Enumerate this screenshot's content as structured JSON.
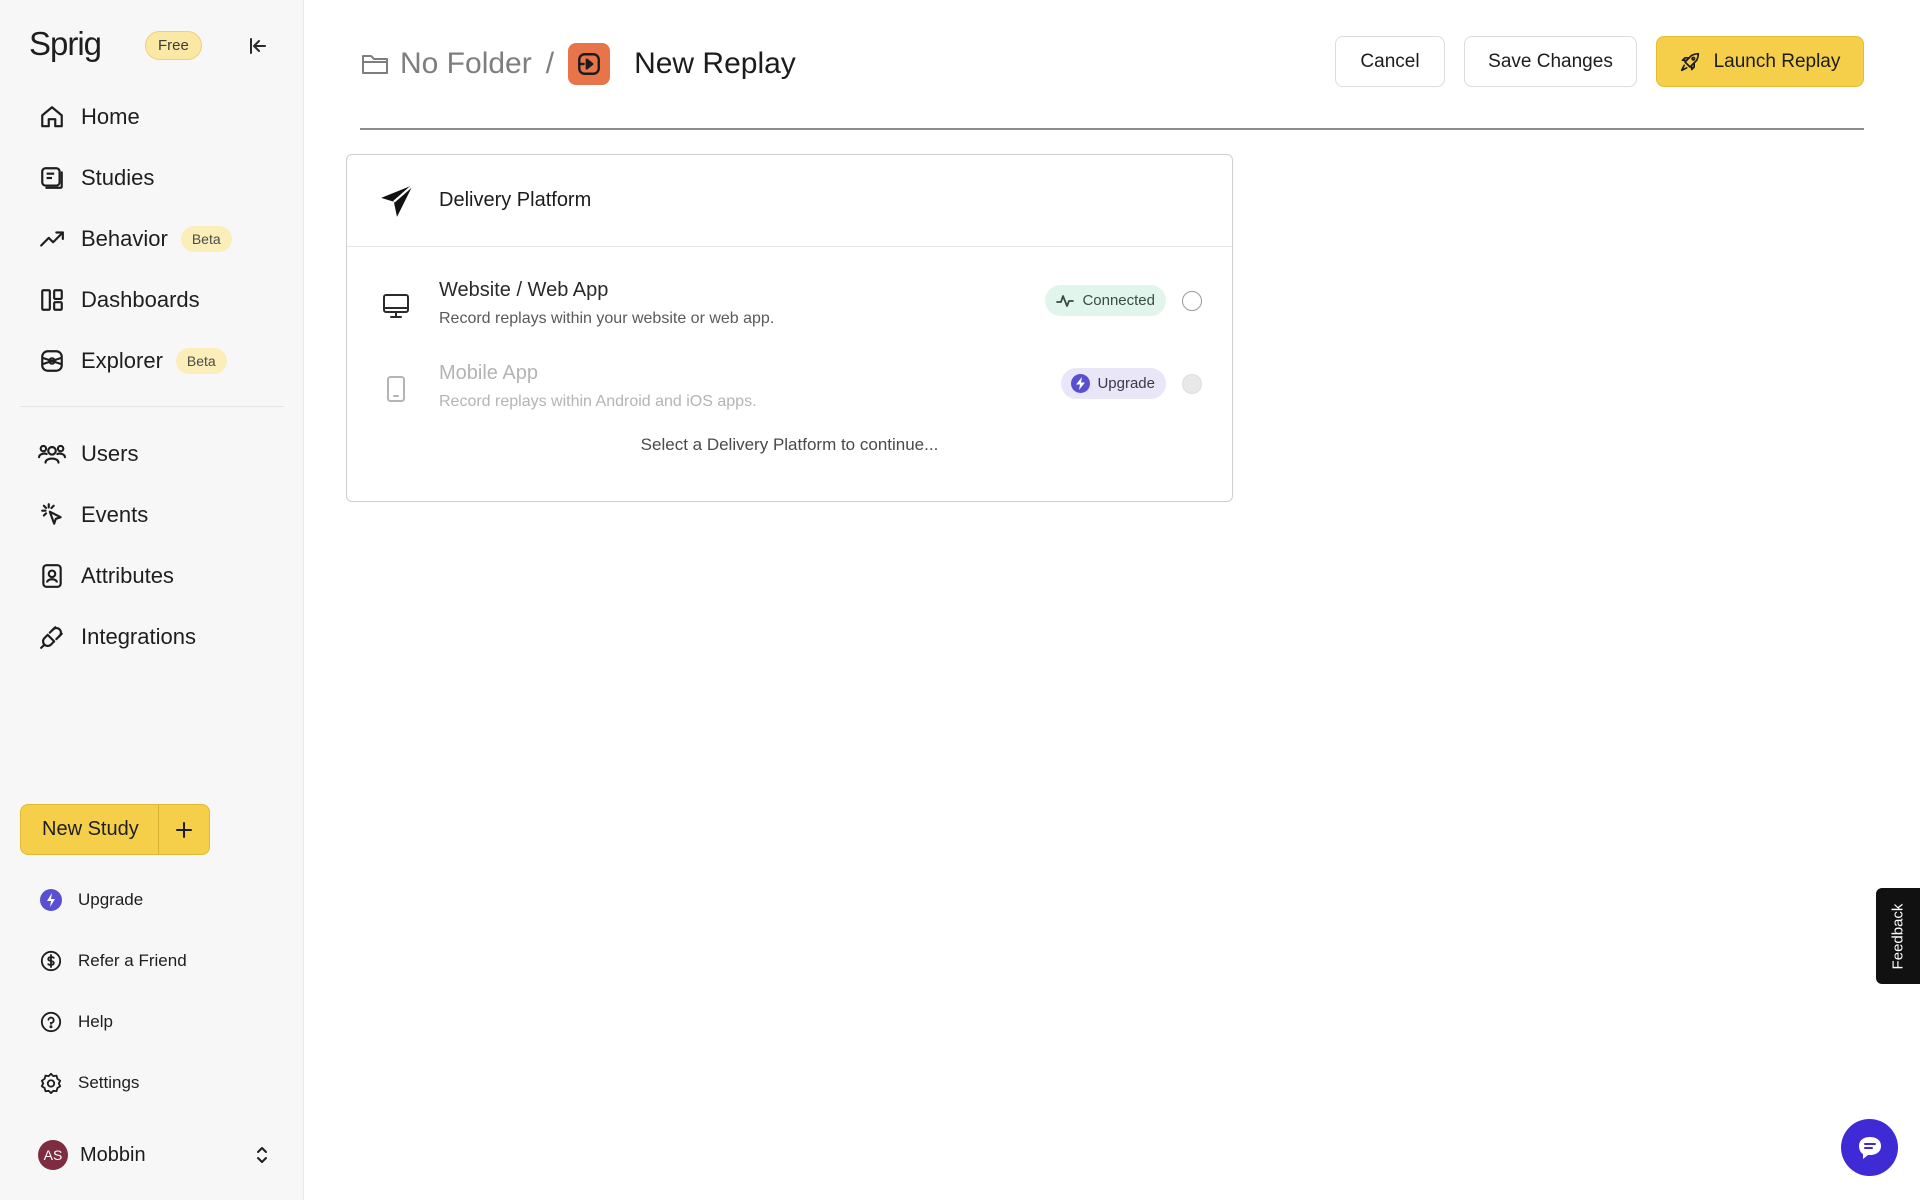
{
  "brand": {
    "logo_text": "Sprig",
    "plan_badge": "Free"
  },
  "sidebar": {
    "nav_primary": [
      {
        "label": "Home",
        "icon": "home-icon"
      },
      {
        "label": "Studies",
        "icon": "studies-icon"
      },
      {
        "label": "Behavior",
        "icon": "trend-icon",
        "badge": "Beta"
      },
      {
        "label": "Dashboards",
        "icon": "dashboards-icon"
      },
      {
        "label": "Explorer",
        "icon": "explorer-icon",
        "badge": "Beta"
      }
    ],
    "nav_secondary": [
      {
        "label": "Users",
        "icon": "users-icon"
      },
      {
        "label": "Events",
        "icon": "events-icon"
      },
      {
        "label": "Attributes",
        "icon": "attributes-icon"
      },
      {
        "label": "Integrations",
        "icon": "plug-icon"
      }
    ],
    "new_study_label": "New Study",
    "footer": [
      {
        "label": "Upgrade",
        "icon": "upgrade-icon"
      },
      {
        "label": "Refer a Friend",
        "icon": "dollar-icon"
      },
      {
        "label": "Help",
        "icon": "help-icon"
      },
      {
        "label": "Settings",
        "icon": "gear-icon"
      }
    ],
    "account": {
      "initials": "AS",
      "name": "Mobbin"
    }
  },
  "header": {
    "folder": "No Folder",
    "separator": "/",
    "title": "New Replay",
    "cancel_label": "Cancel",
    "save_label": "Save Changes",
    "launch_label": "Launch Replay"
  },
  "delivery": {
    "title": "Delivery Platform",
    "options": [
      {
        "title": "Website / Web App",
        "description": "Record replays within your website or web app.",
        "status": "Connected",
        "selected": false,
        "disabled": false
      },
      {
        "title": "Mobile App",
        "description": "Record replays within Android and iOS apps.",
        "status": "Upgrade",
        "selected": false,
        "disabled": true
      }
    ],
    "hint": "Select a Delivery Platform to continue..."
  },
  "feedback_label": "Feedback",
  "colors": {
    "accent_yellow": "#f5cf4a",
    "replay_orange": "#e8744a",
    "upgrade_purple": "#5b4fd1",
    "chat_blue": "#3f2bd6",
    "connected_green_bg": "#e2f5ec",
    "avatar_maroon": "#7d2d3f"
  }
}
